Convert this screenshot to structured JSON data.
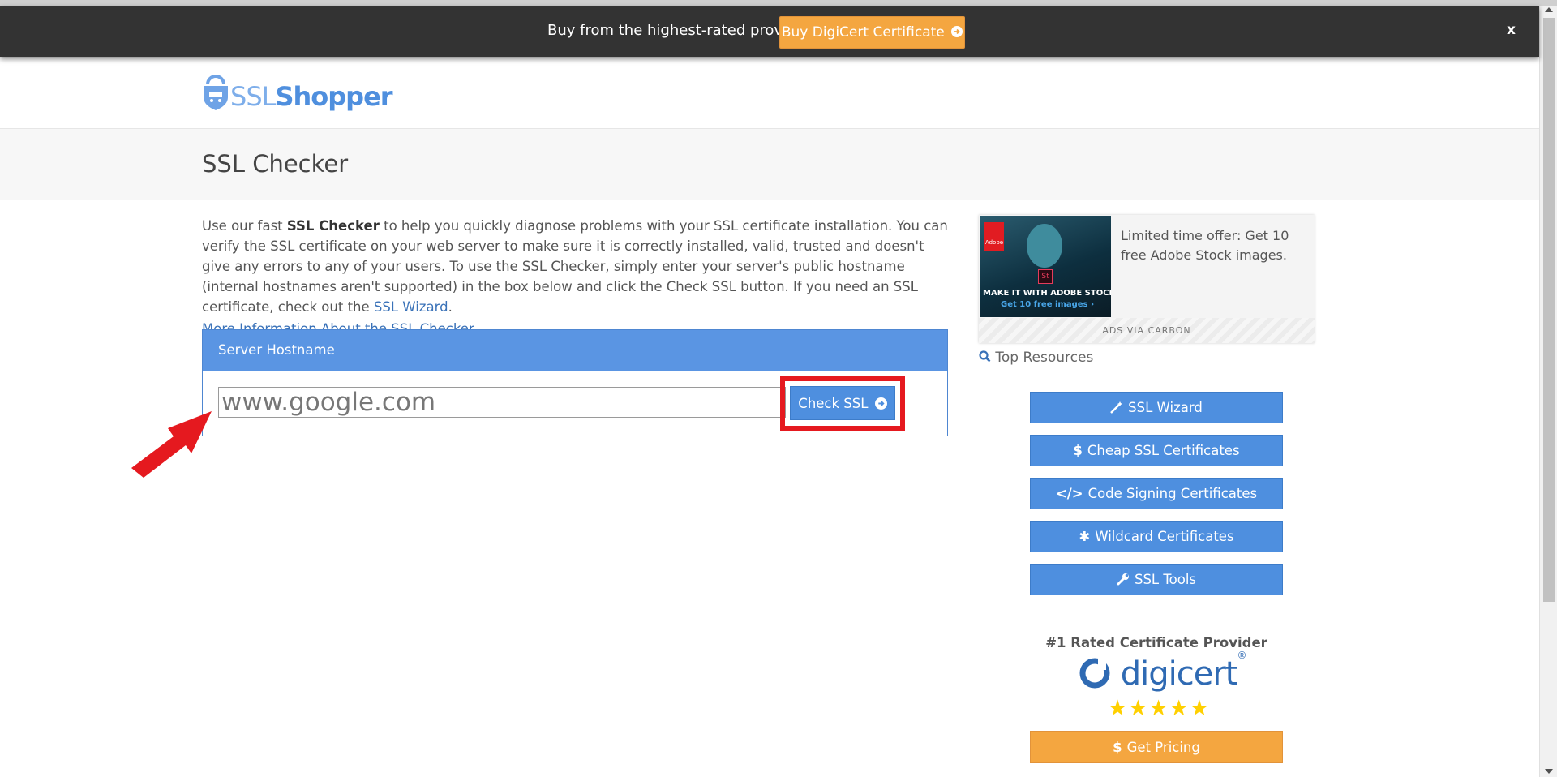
{
  "promo_bar": {
    "text": "Buy from the highest-rated provider",
    "button_label": "Buy DigiCert Certificate",
    "close_label": "x"
  },
  "logo": {
    "part1": "SSL",
    "part2": "Shopper"
  },
  "page_title": "SSL Checker",
  "intro": {
    "text_before": "Use our fast ",
    "bold": "SSL Checker",
    "text_after": " to help you quickly diagnose problems with your SSL certificate installation. You can verify the SSL certificate on your web server to make sure it is correctly installed, valid, trusted and doesn't give any errors to any of your users. To use the SSL Checker, simply enter your server's public hostname (internal hostnames aren't supported) in the box below and click the Check SSL button. If you need an SSL certificate, check out the ",
    "link": "SSL Wizard",
    "end": "."
  },
  "more_info_link": "More Information About the SSL Checker",
  "form": {
    "heading": "Server Hostname",
    "input_value": "www.google.com",
    "button_label": "Check SSL"
  },
  "ad": {
    "image_caption_1": "MAKE IT WITH ADOBE STOCK.",
    "image_caption_2": "Get 10 free images ›",
    "image_brand": "Adobe",
    "image_badge": "St",
    "text": "Limited time offer: Get 10 free Adobe Stock images.",
    "footer": "ADS VIA CARBON"
  },
  "sidebar": {
    "top_resources": "Top Resources",
    "buttons": [
      {
        "label": "SSL Wizard",
        "icon": "magic-wand-icon"
      },
      {
        "label": "Cheap SSL Certificates",
        "icon": "dollar-icon"
      },
      {
        "label": "Code Signing Certificates",
        "icon": "code-icon"
      },
      {
        "label": "Wildcard Certificates",
        "icon": "asterisk-icon"
      },
      {
        "label": "SSL Tools",
        "icon": "wrench-icon"
      }
    ],
    "rated_title": "#1 Rated Certificate Provider",
    "brand": "digicert",
    "stars": 5,
    "pricing_label": "Get Pricing"
  },
  "colors": {
    "accent_blue": "#4e8fdf",
    "orange": "#f4a640",
    "highlight_red": "#e5191f",
    "promo_bg": "#333333"
  }
}
